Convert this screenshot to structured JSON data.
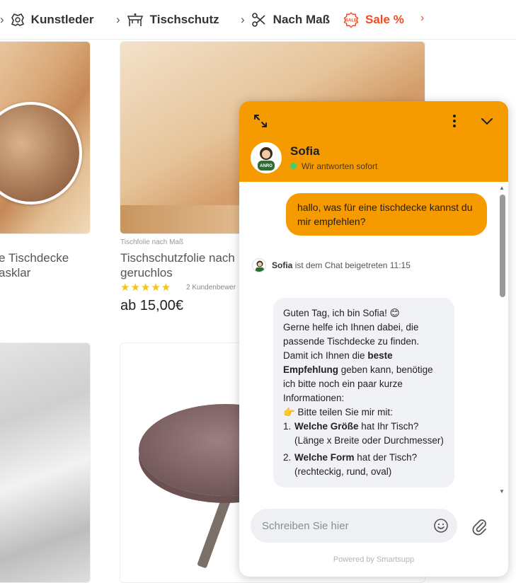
{
  "nav": {
    "items": [
      {
        "label": "Kunstleder",
        "icon": "leather-icon"
      },
      {
        "label": "Tischschutz",
        "icon": "table-cover-icon"
      },
      {
        "label": "Nach Maß",
        "icon": "scissors-icon"
      },
      {
        "label": "Sale %",
        "icon": "sale-badge-icon"
      }
    ],
    "sale_color": "#ef4a23"
  },
  "products": [
    {
      "title_line1": "e Tischdecke",
      "title_line2": "asklar"
    },
    {
      "subtitle": "Tischfolie nach Maß",
      "title_line1": "Tischschutzfolie nach",
      "title_line2": "geruchlos",
      "stars": "★★★★★",
      "reviews": "2 Kundenbewer",
      "price": "ab 15,00€"
    }
  ],
  "chat": {
    "accent": "#f59b00",
    "agent_name": "Sofia",
    "agent_status": "Wir antworten sofort",
    "avatar_label": "ANRO",
    "user_message": "hallo, was für eine tischdecke kannst du mir empfehlen?",
    "join_name": "Sofia",
    "join_text": "ist dem Chat beigetreten 11:15",
    "bot_message": {
      "greeting": "Guten Tag, ich bin Sofia! 😊",
      "p1": "Gerne helfe ich Ihnen dabei, die passende Tischdecke zu finden. Damit ich Ihnen die",
      "p1_bold": "beste Empfehlung",
      "p1_end": "geben kann, benötige ich bitte noch ein paar kurze Informationen:",
      "share": "👉 Bitte teilen Sie mir mit:",
      "q1_num": "1.",
      "q1_bold": "Welche Größe",
      "q1_rest": "hat Ihr Tisch? (Länge x Breite oder Durchmesser)",
      "q2_num": "2.",
      "q2_bold": "Welche Form",
      "q2_rest": "hat der Tisch? (rechteckig, rund, oval)"
    },
    "input_placeholder": "Schreiben Sie hier",
    "powered_by": "Powered by Smartsupp"
  }
}
